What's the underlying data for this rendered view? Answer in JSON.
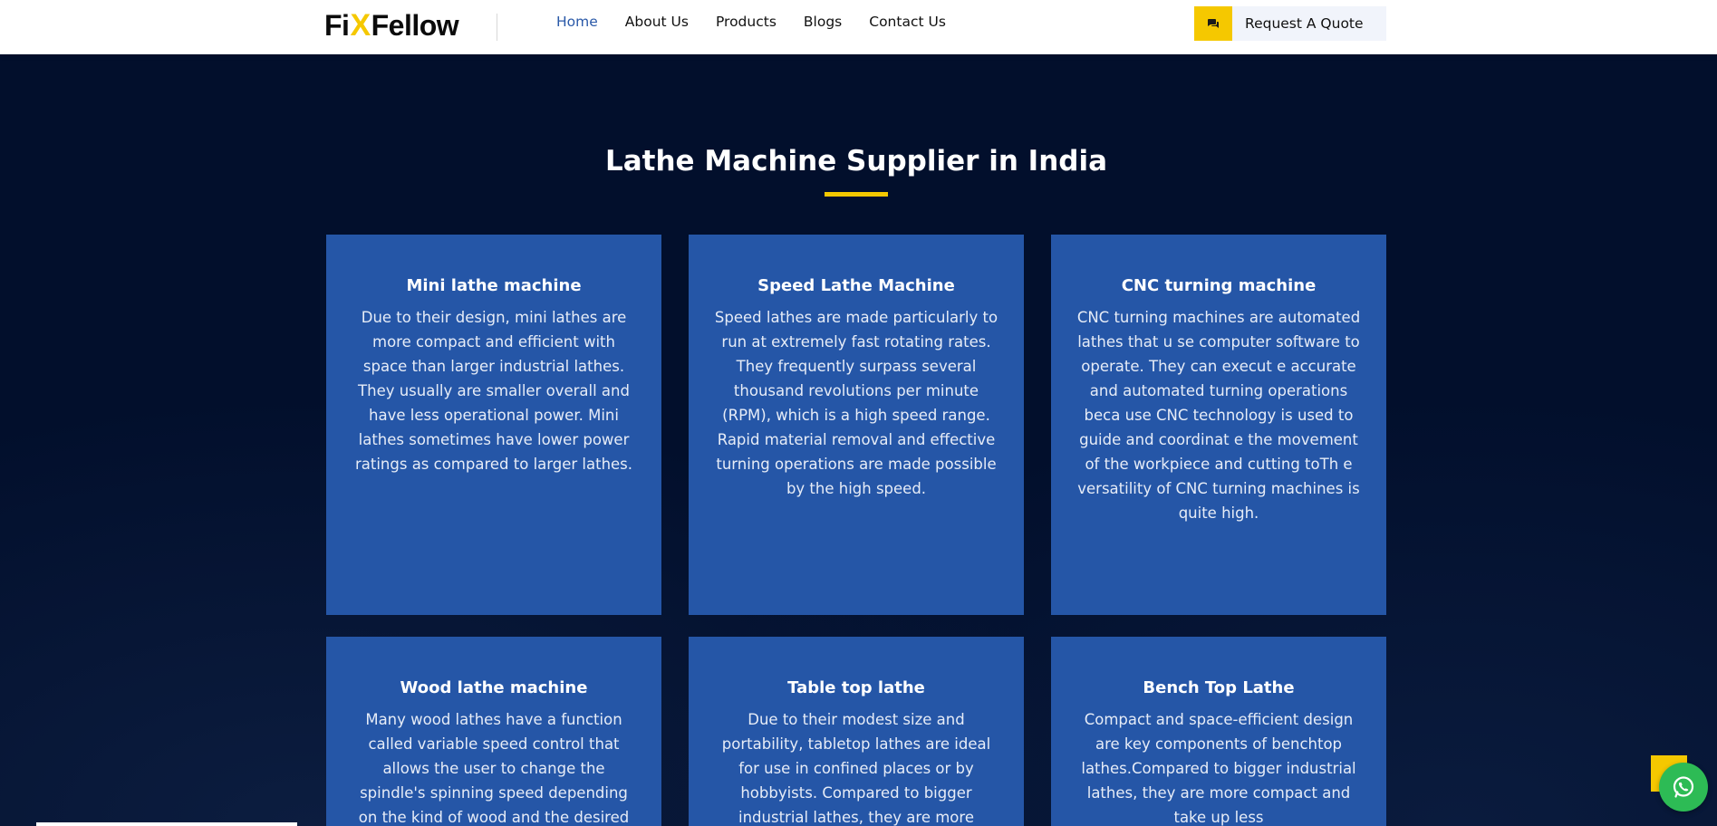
{
  "brand": {
    "logo_left": "Fi",
    "logo_x": "X",
    "logo_right": "Fellow"
  },
  "nav": {
    "items": [
      {
        "label": "Home",
        "active": true
      },
      {
        "label": "About Us",
        "active": false
      },
      {
        "label": "Products",
        "active": false
      },
      {
        "label": "Blogs",
        "active": false
      },
      {
        "label": "Contact Us",
        "active": false
      }
    ],
    "quote_label": "Request A Quote",
    "quote_icon": "chat-icon"
  },
  "section": {
    "title": "Lathe Machine Supplier in India"
  },
  "cards": [
    {
      "title": "Mini lathe machine",
      "body": "Due to their design, mini lathes are more compact and efficient with space than larger industrial lathes. They usually are smaller overall and have less operational power. Mini lathes sometimes have lower power ratings as compared to larger lathes."
    },
    {
      "title": "Speed Lathe Machine",
      "body": "Speed lathes are made particularly to run at extremely fast rotating rates. They frequently surpass several thousand revolutions per minute (RPM), which is a high speed range. Rapid material removal and effective turning operations are made possible by the high speed."
    },
    {
      "title": "CNC turning machine",
      "body": "CNC turning machines are automated lathes that u se computer software to operate. They can execut e accurate and automated turning operations beca use CNC technology is used to guide and coordinat e the movement of the workpiece and cutting toTh e versatility of CNC turning machines is quite high."
    },
    {
      "title": "Wood lathe machine",
      "body": "Many wood lathes have a function called variable speed control that allows the user to change the spindle's spinning speed depending on the kind of wood and the desired"
    },
    {
      "title": "Table top lathe",
      "body": "Due to their modest size and portability, tabletop lathes are ideal for use in confined places or by hobbyists. Compared to bigger industrial lathes, they are more"
    },
    {
      "title": "Bench Top Lathe",
      "body": "Compact and space-efficient design are key components of benchtop lathes.Compared to bigger industrial lathes, they are more compact and take up less"
    }
  ],
  "floating": {
    "whatsapp_icon": "whatsapp-icon",
    "scroll_icon": "scroll-top-icon"
  },
  "colors": {
    "accent": "#f5c800",
    "card_bg": "#2556a7",
    "page_bg": "#020f2c",
    "nav_active": "#2a59a8",
    "whatsapp": "#2dbb55"
  }
}
